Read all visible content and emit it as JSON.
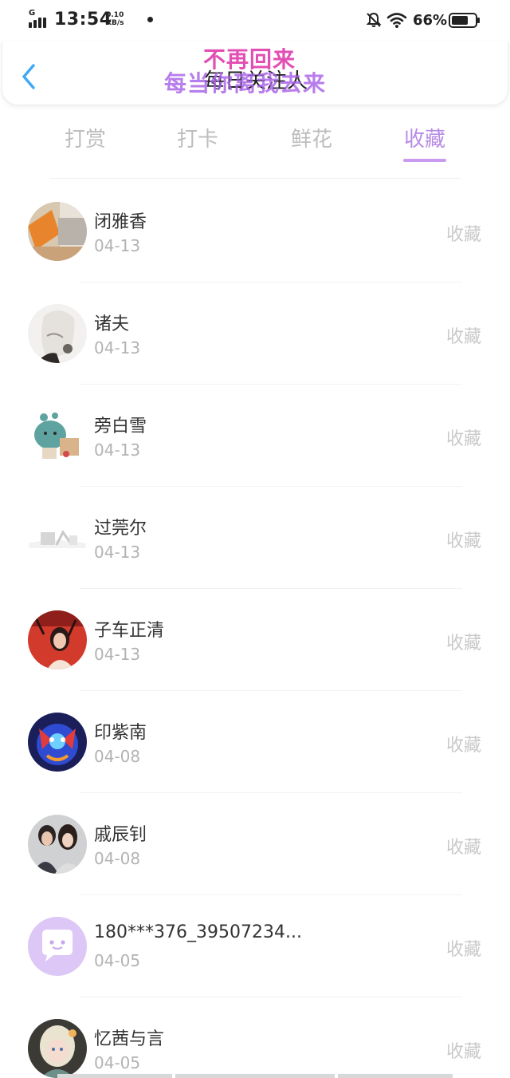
{
  "status_bar": {
    "network": "G",
    "time": "13:54",
    "speed_value": "0.10",
    "speed_unit": "KB/s",
    "battery": "66%"
  },
  "header": {
    "title": "每日关注人",
    "watermark_line1": "不再回来",
    "watermark_line2": "每当你离我去来"
  },
  "tabs": [
    {
      "label": "打赏",
      "active": false
    },
    {
      "label": "打卡",
      "active": false
    },
    {
      "label": "鲜花",
      "active": false
    },
    {
      "label": "收藏",
      "active": true
    }
  ],
  "colors": {
    "accent": "#c89bf0",
    "tab_active": "#b78ce6",
    "tab_inactive": "#bdbdbd",
    "back_arrow": "#3fa9f5"
  },
  "list": [
    {
      "name": "闭雅香",
      "date": "04-13",
      "action": "收藏",
      "avatar": "avatar-desk-photo"
    },
    {
      "name": "诸夫",
      "date": "04-13",
      "action": "收藏",
      "avatar": "avatar-sketch-portrait"
    },
    {
      "name": "旁白雪",
      "date": "04-13",
      "action": "收藏",
      "avatar": "avatar-cartoon-cactus"
    },
    {
      "name": "过莞尔",
      "date": "04-13",
      "action": "收藏",
      "avatar": "avatar-faded-sketch"
    },
    {
      "name": "子车正清",
      "date": "04-13",
      "action": "收藏",
      "avatar": "avatar-red-portrait"
    },
    {
      "name": "印紫南",
      "date": "04-08",
      "action": "收藏",
      "avatar": "avatar-game-character"
    },
    {
      "name": "戚辰钊",
      "date": "04-08",
      "action": "收藏",
      "avatar": "avatar-couple-photo"
    },
    {
      "name": "180***376_39507234...",
      "date": "04-05",
      "action": "收藏",
      "avatar": "avatar-default-chat"
    },
    {
      "name": "忆茜与言",
      "date": "04-05",
      "action": "收藏",
      "avatar": "avatar-anime-girl"
    }
  ]
}
